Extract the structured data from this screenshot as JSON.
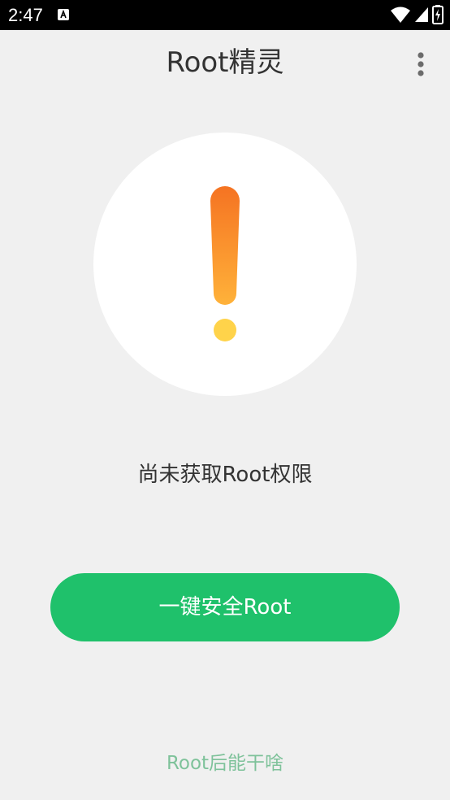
{
  "status_bar": {
    "time": "2:47",
    "background": "#000000",
    "icons": [
      "a-notification-icon",
      "wifi-icon",
      "signal-icon",
      "battery-icon"
    ]
  },
  "app_bar": {
    "title": "Root精灵",
    "menu_icon": "more-vert-icon"
  },
  "main": {
    "status_icon": "warning-exclamation-icon",
    "status_message": "尚未获取Root权限",
    "primary_button_label": "一键安全Root",
    "help_link": "Root后能干啥"
  },
  "colors": {
    "background": "#f0f0f0",
    "primary_green": "#1fc16b",
    "link_green": "#7ec29a",
    "warning_orange": "#f57322",
    "warning_yellow": "#ffd34a",
    "text_dark": "#333333"
  }
}
